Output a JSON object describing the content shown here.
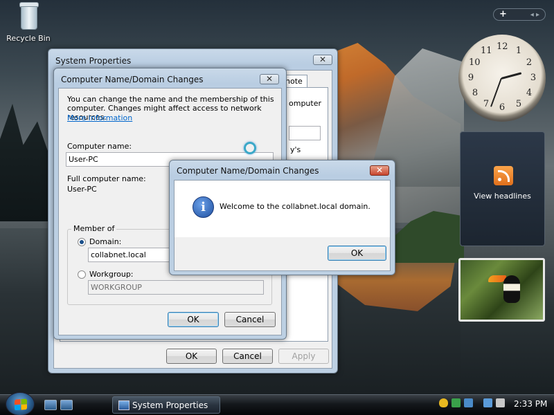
{
  "desktop": {
    "recycle_bin_label": "Recycle Bin"
  },
  "sidebar": {
    "add_symbol": "+",
    "nav_arrows": "◂ ▸",
    "news_label": "View headlines"
  },
  "clock_face": [
    "12",
    "1",
    "2",
    "3",
    "4",
    "5",
    "6",
    "7",
    "8",
    "9",
    "10",
    "11"
  ],
  "system_properties": {
    "title": "System Properties",
    "visible_tab_fragment": "note",
    "fragments": [
      "omputer",
      "y's"
    ],
    "buttons": {
      "ok": "OK",
      "cancel": "Cancel",
      "apply": "Apply"
    }
  },
  "name_changes": {
    "title": "Computer Name/Domain Changes",
    "close_symbol": "✕",
    "description": "You can change the name and the membership of this computer. Changes might affect access to network resources.",
    "more_info_link": "More information",
    "computer_name_label": "Computer name:",
    "computer_name_value": "User-PC",
    "full_name_label": "Full computer name:",
    "full_name_value": "User-PC",
    "member_of_label": "Member of",
    "domain_label": "Domain:",
    "domain_value": "collabnet.local",
    "domain_selected": true,
    "workgroup_label": "Workgroup:",
    "workgroup_value": "WORKGROUP",
    "buttons": {
      "ok": "OK",
      "cancel": "Cancel"
    }
  },
  "welcome_dialog": {
    "title": "Computer Name/Domain Changes",
    "close_symbol": "✕",
    "info_symbol": "i",
    "message": "Welcome to the collabnet.local domain.",
    "ok": "OK"
  },
  "taskbar": {
    "task_label": "System Properties",
    "time": "2:33 PM"
  },
  "colors": {
    "link": "#0066cc",
    "accent": "#3c7fb1",
    "info": "#1e4fa0"
  }
}
